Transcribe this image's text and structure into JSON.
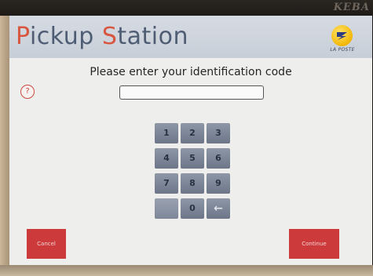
{
  "device": {
    "brand_emboss": "KEBA"
  },
  "header": {
    "title_part1": "P",
    "title_part2": "ickup ",
    "title_part3": "S",
    "title_part4": "tation",
    "logo_text": "LA POSTE",
    "accent_color": "#d8563f",
    "title_color": "#4f5d74"
  },
  "main": {
    "prompt": "Please enter your identification code",
    "help_label": "?",
    "code_value": "",
    "code_placeholder": ""
  },
  "keypad": {
    "keys": [
      "1",
      "2",
      "3",
      "4",
      "5",
      "6",
      "7",
      "8",
      "9",
      "",
      "0",
      "←"
    ],
    "backspace_icon": "backspace-arrow-icon"
  },
  "footer": {
    "cancel_label": "Cancel",
    "continue_label": "Continue",
    "button_color": "#cc3a3c"
  }
}
